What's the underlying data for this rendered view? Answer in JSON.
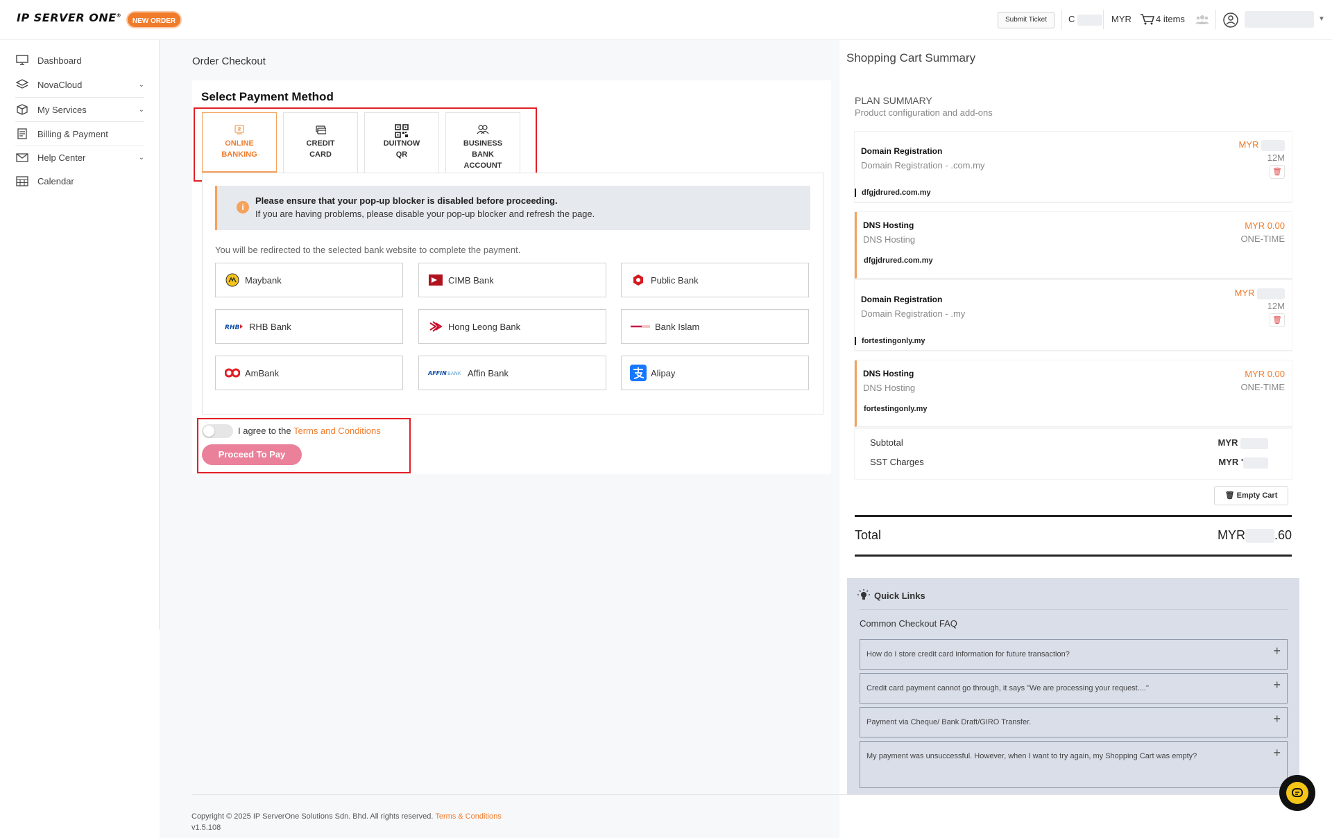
{
  "header": {
    "logo": "IP SERVER ONE",
    "logo_mark": "®",
    "new_order": "NEW ORDER",
    "submit_ticket": "Submit Ticket",
    "account_initial": "C",
    "currency": "MYR",
    "cart_items": "4 items"
  },
  "sidebar": {
    "items": [
      {
        "label": "Dashboard"
      },
      {
        "label": "NovaCloud"
      },
      {
        "label": "My Services"
      },
      {
        "label": "Billing & Payment"
      },
      {
        "label": "Help Center"
      },
      {
        "label": "Calendar"
      }
    ]
  },
  "checkout": {
    "title": "Order Checkout",
    "heading": "Select Payment Method",
    "tabs": [
      {
        "line1": "ONLINE",
        "line2": "BANKING",
        "line3": ""
      },
      {
        "line1": "CREDIT",
        "line2": "CARD",
        "line3": ""
      },
      {
        "line1": "DUITNOW",
        "line2": "QR",
        "line3": ""
      },
      {
        "line1": "BUSINESS",
        "line2": "BANK",
        "line3": "ACCOUNT"
      }
    ],
    "alert_title": "Please ensure that your pop-up blocker is disabled before proceeding.",
    "alert_body": "If you are having problems, please disable your pop-up blocker and refresh the page.",
    "redirect_note": "You will be redirected to the selected bank website to complete the payment.",
    "banks": [
      {
        "label": "Maybank"
      },
      {
        "label": "CIMB Bank"
      },
      {
        "label": "Public Bank"
      },
      {
        "label": "RHB Bank"
      },
      {
        "label": "Hong Leong Bank"
      },
      {
        "label": "Bank Islam"
      },
      {
        "label": "AmBank"
      },
      {
        "label": "Affin Bank"
      },
      {
        "label": "Alipay"
      }
    ],
    "agree_prefix": "I agree to the ",
    "agree_link": "Terms and Conditions",
    "proceed": "Proceed To Pay"
  },
  "cart": {
    "title": "Shopping Cart Summary",
    "plan_head": "PLAN SUMMARY",
    "plan_sub": "Product configuration and add-ons",
    "items": [
      {
        "name": "Domain Registration",
        "desc": "Domain Registration - .com.my",
        "price": "MYR",
        "cycle": "12M",
        "domain": "dfgjdrured.com.my"
      },
      {
        "name": "DNS Hosting",
        "desc": "DNS Hosting",
        "price": "MYR 0.00",
        "cycle": "ONE-TIME",
        "domain": "dfgjdrured.com.my"
      },
      {
        "name": "Domain Registration",
        "desc": "Domain Registration - .my",
        "price": "MYR",
        "cycle": "12M",
        "domain": "fortestingonly.my"
      },
      {
        "name": "DNS Hosting",
        "desc": "DNS Hosting",
        "price": "MYR 0.00",
        "cycle": "ONE-TIME",
        "domain": "fortestingonly.my"
      }
    ],
    "subtotal_label": "Subtotal",
    "subtotal_value": "MYR",
    "sst_label": "SST Charges",
    "sst_value": "MYR '",
    "empty_cart": "Empty Cart",
    "total_label": "Total",
    "total_prefix": "MYR",
    "total_suffix": ".60"
  },
  "quick_links": {
    "title": "Quick Links",
    "faq_title": "Common Checkout FAQ",
    "faqs": [
      {
        "q": "How do I store credit card information for future transaction?"
      },
      {
        "q": "Credit card payment cannot go through, it says \"We are processing your request....\""
      },
      {
        "q": "Payment via Cheque/ Bank Draft/GIRO Transfer."
      },
      {
        "q": "My payment was unsuccessful. However, when I want to try again, my Shopping Cart was empty?"
      }
    ]
  },
  "footer": {
    "copyright": "Copyright © 2025 IP ServerOne Solutions Sdn. Bhd. All rights reserved.",
    "terms": "Terms & Conditions",
    "version": "v1.5.108"
  },
  "colors": {
    "accent": "#f07b2b",
    "highlight_box": "#e01f26",
    "proceed_button": "#e8738e",
    "quick_links_bg": "#d9dee8"
  }
}
